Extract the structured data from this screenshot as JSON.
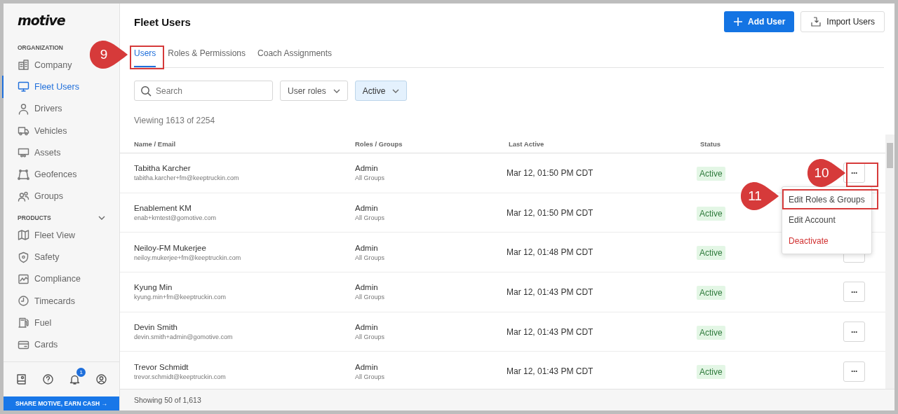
{
  "sidebar": {
    "logo": "motive",
    "sections": [
      {
        "title": "ORGANIZATION",
        "collapsible": false,
        "items": [
          {
            "label": "Company",
            "selected": false
          },
          {
            "label": "Fleet Users",
            "selected": true
          },
          {
            "label": "Drivers",
            "selected": false
          },
          {
            "label": "Vehicles",
            "selected": false
          },
          {
            "label": "Assets",
            "selected": false
          },
          {
            "label": "Geofences",
            "selected": false
          },
          {
            "label": "Groups",
            "selected": false
          }
        ]
      },
      {
        "title": "PRODUCTS",
        "collapsible": true,
        "items": [
          {
            "label": "Fleet View",
            "selected": false
          },
          {
            "label": "Safety",
            "selected": false
          },
          {
            "label": "Compliance",
            "selected": false
          },
          {
            "label": "Timecards",
            "selected": false
          },
          {
            "label": "Fuel",
            "selected": false
          },
          {
            "label": "Cards",
            "selected": false
          }
        ]
      }
    ],
    "notification_count": "1",
    "banner": "SHARE MOTIVE, EARN CASH →"
  },
  "page": {
    "title": "Fleet Users",
    "primary_button": "Add User",
    "secondary_button": "Import Users",
    "tabs": [
      {
        "label": "Users",
        "selected": true
      },
      {
        "label": "Roles & Permissions",
        "selected": false
      },
      {
        "label": "Coach Assignments",
        "selected": false
      }
    ],
    "search": {
      "placeholder": "Search"
    },
    "filters": [
      {
        "label": "User roles",
        "active": false
      },
      {
        "label": "Active",
        "active": true
      }
    ],
    "count": "Viewing 1613 of 2254",
    "table": {
      "columns": [
        "Name / Email",
        "Roles / Groups",
        "Last Active",
        "Status"
      ],
      "rows": [
        {
          "name": "Tabitha Karcher",
          "email": "tabitha.karcher+fm@keeptruckin.com",
          "role": "Admin",
          "groups": "All Groups",
          "last_active": "Mar 12, 01:50 PM CDT",
          "status": "Active",
          "actions": "···"
        },
        {
          "name": "Enablement KM",
          "email": "enab+kmtest@gomotive.com",
          "role": "Admin",
          "groups": "All Groups",
          "last_active": "Mar 12, 01:50 PM CDT",
          "status": "Active"
        },
        {
          "name": "Neiloy-FM Mukerjee",
          "email": "neiloy.mukerjee+fm@keeptruckin.com",
          "role": "Admin",
          "groups": "All Groups",
          "last_active": "Mar 12, 01:48 PM CDT",
          "status": "Active",
          "button_covered": true
        },
        {
          "name": "Kyung Min",
          "email": "kyung.min+fm@keeptruckin.com",
          "role": "Admin",
          "groups": "All Groups",
          "last_active": "Mar 12, 01:43 PM CDT",
          "status": "Active",
          "actions": "···"
        },
        {
          "name": "Devin Smith",
          "email": "devin.smith+admin@gomotive.com",
          "role": "Admin",
          "groups": "All Groups",
          "last_active": "Mar 12, 01:43 PM CDT",
          "status": "Active",
          "actions": "···"
        },
        {
          "name": "Trevor Schmidt",
          "email": "trevor.schmidt@keeptruckin.com",
          "role": "Admin",
          "groups": "All Groups",
          "last_active": "Mar 12, 01:43 PM CDT",
          "status": "Active",
          "actions": "···"
        }
      ]
    },
    "row_menu": {
      "items": [
        {
          "label": "Edit Roles & Groups",
          "kind": "normal"
        },
        {
          "label": "Edit Account",
          "kind": "normal"
        },
        {
          "label": "Deactivate",
          "kind": "danger"
        }
      ]
    },
    "footer": "Showing 50 of 1,613"
  },
  "callouts": [
    {
      "label": "9"
    },
    {
      "label": "10"
    },
    {
      "label": "11"
    }
  ]
}
